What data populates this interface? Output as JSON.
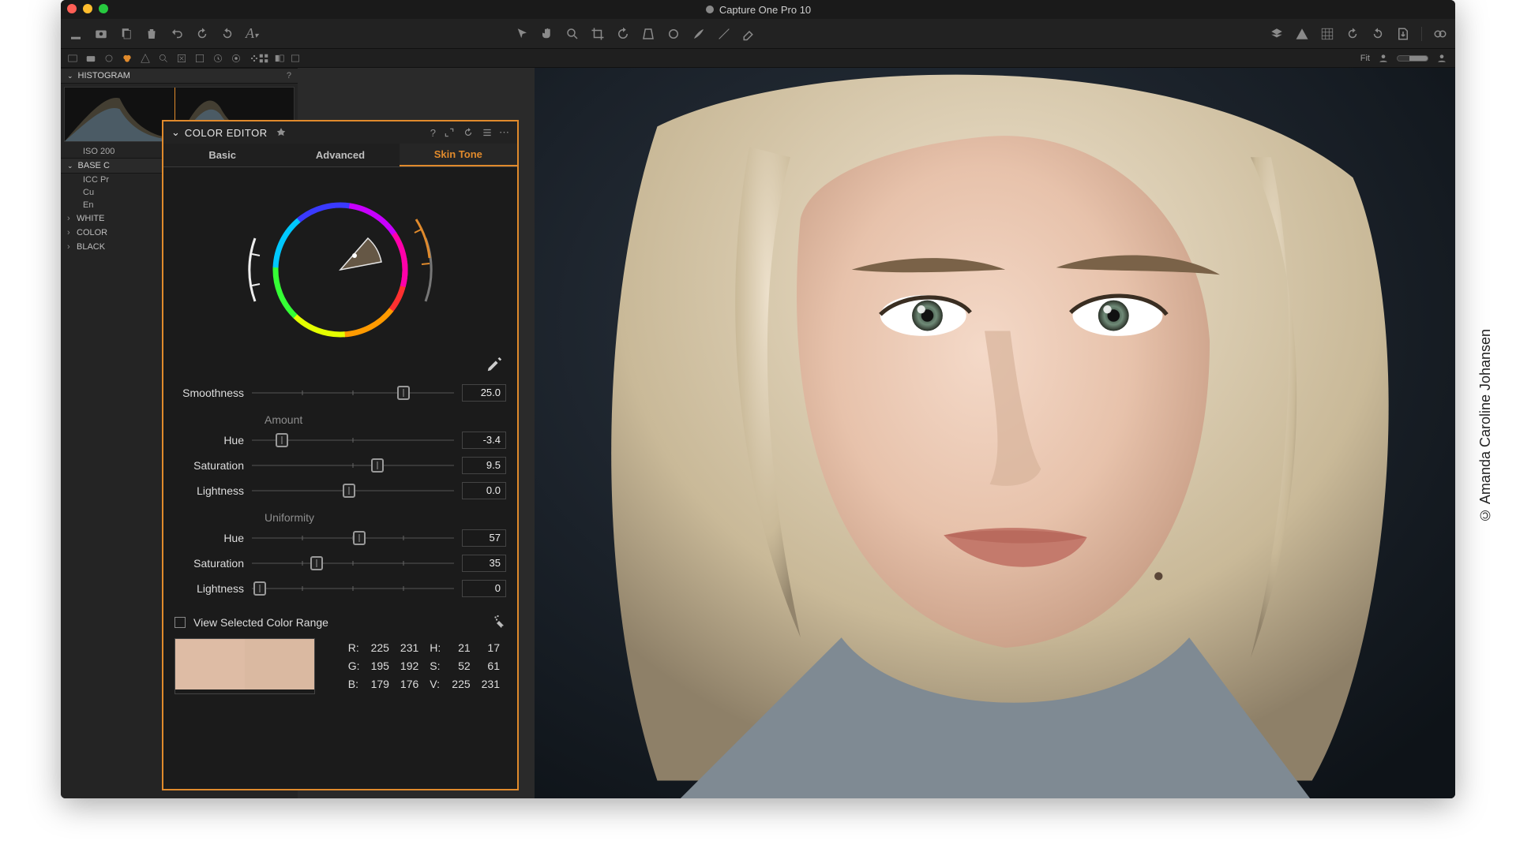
{
  "window": {
    "title": "Capture One Pro 10"
  },
  "sidebar": {
    "histogram_label": "HISTOGRAM",
    "iso_label": "ISO 200",
    "base_label": "BASE C",
    "rows": {
      "icc": "ICC Pr",
      "cu": "Cu",
      "en": "En"
    },
    "sections": {
      "white": "WHITE",
      "color": "COLOR",
      "black": "BLACK"
    }
  },
  "color_editor": {
    "title": "COLOR EDITOR",
    "tabs": {
      "basic": "Basic",
      "advanced": "Advanced",
      "skin": "Skin Tone"
    },
    "smoothness": {
      "label": "Smoothness",
      "value": "25.0",
      "pos": 75
    },
    "amount_label": "Amount",
    "amount": {
      "hue": {
        "label": "Hue",
        "value": "-3.4",
        "pos": 15
      },
      "saturation": {
        "label": "Saturation",
        "value": "9.5",
        "pos": 62
      },
      "lightness": {
        "label": "Lightness",
        "value": "0.0",
        "pos": 48
      }
    },
    "uniformity_label": "Uniformity",
    "uniformity": {
      "hue": {
        "label": "Hue",
        "value": "57",
        "pos": 53
      },
      "saturation": {
        "label": "Saturation",
        "value": "35",
        "pos": 32
      },
      "lightness": {
        "label": "Lightness",
        "value": "0",
        "pos": 4
      }
    },
    "view_selected": "View Selected Color Range",
    "swatches": [
      "#debca5",
      "#dab9a1"
    ],
    "readout": {
      "R": [
        "225",
        "231"
      ],
      "G": [
        "195",
        "192"
      ],
      "B": [
        "179",
        "176"
      ],
      "H": [
        "21",
        "17"
      ],
      "S": [
        "52",
        "61"
      ],
      "V": [
        "225",
        "231"
      ]
    }
  },
  "viewer": {
    "fit_label": "Fit"
  },
  "credit": "© Amanda Caroline Johansen"
}
